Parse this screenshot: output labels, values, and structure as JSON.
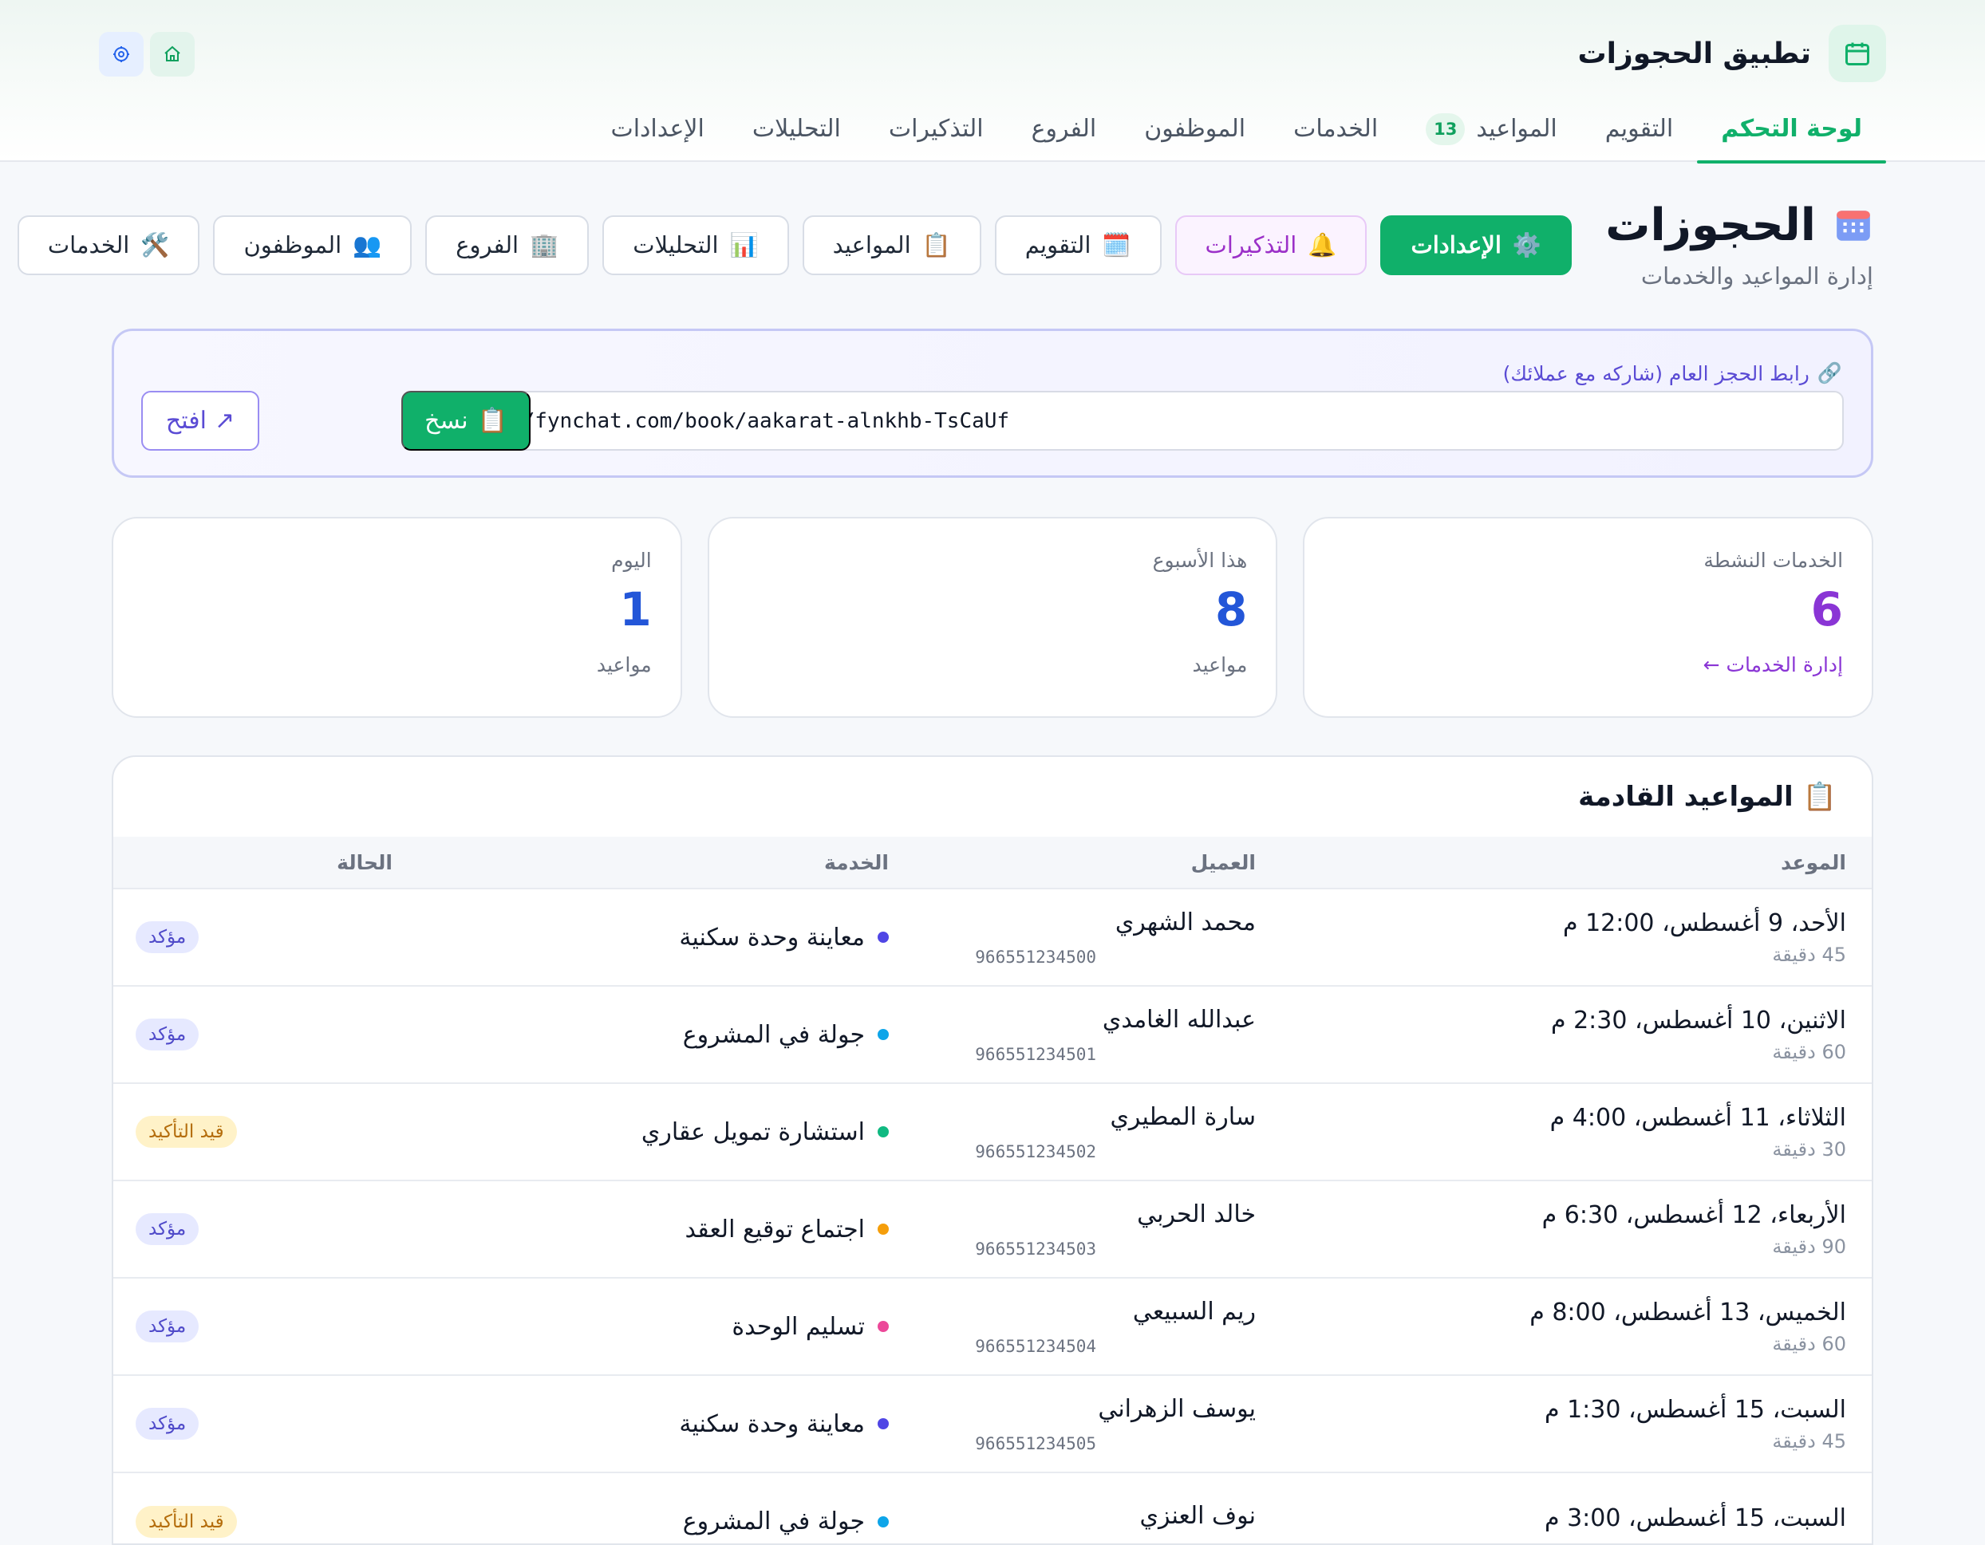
{
  "header": {
    "app_title": "تطبيق الحجوزات",
    "brand_icon": "calendar-icon",
    "top_icons": [
      "home-icon",
      "settings-icon"
    ],
    "tabs": [
      {
        "label": "لوحة التحكم",
        "active": true
      },
      {
        "label": "التقويم",
        "active": false
      },
      {
        "label": "المواعيد",
        "active": false,
        "badge": "13"
      },
      {
        "label": "الخدمات",
        "active": false
      },
      {
        "label": "الموظفون",
        "active": false
      },
      {
        "label": "الفروع",
        "active": false
      },
      {
        "label": "التذكيرات",
        "active": false
      },
      {
        "label": "التحليلات",
        "active": false
      },
      {
        "label": "الإعدادات",
        "active": false
      }
    ]
  },
  "page": {
    "title": "الحجوزات",
    "subtitle": "إدارة المواعيد والخدمات",
    "title_icon": "grid-calendar-icon",
    "quick_actions": [
      {
        "label": "الخدمات",
        "icon": "tools-icon"
      },
      {
        "label": "الموظفون",
        "icon": "users-icon"
      },
      {
        "label": "الفروع",
        "icon": "building-icon"
      },
      {
        "label": "التحليلات",
        "icon": "bar-chart-icon"
      },
      {
        "label": "المواعيد",
        "icon": "clipboard-icon"
      },
      {
        "label": "التقويم",
        "icon": "calendar-icon"
      },
      {
        "label": "التذكيرات",
        "icon": "bell-icon"
      },
      {
        "label": "الإعدادات",
        "icon": "gear-icon"
      }
    ]
  },
  "booking_link": {
    "label": "رابط الحجز العام (شاركه مع عملائك)",
    "url": "https://fynchat.com/book/aakarat-alnkhb-TsCaUf",
    "copy_label": "نسخ",
    "open_label": "افتح",
    "icons": [
      "link-icon",
      "clipboard-icon",
      "external-link-icon"
    ]
  },
  "stats": [
    {
      "label": "اليوم",
      "value": "1",
      "foot": "مواعيد",
      "color": "#2356d8"
    },
    {
      "label": "هذا الأسبوع",
      "value": "8",
      "foot": "مواعيد",
      "color": "#2356d8"
    },
    {
      "label": "الخدمات النشطة",
      "value": "6",
      "foot": "إدارة الخدمات ←",
      "color": "#8a35d5"
    }
  ],
  "upcoming": {
    "title": "المواعيد القادمة",
    "title_icon": "clipboard-icon",
    "columns": [
      "الموعد",
      "العميل",
      "الخدمة",
      "الحالة"
    ],
    "rows": [
      {
        "datetime": "الأحد، 9 أغسطس، 12:00 م",
        "duration": "45 دقيقة",
        "customer": "محمد الشهري",
        "phone": "966551234500",
        "service": "معاينة وحدة سكنية",
        "service_color": "#5046e5",
        "status": "مؤكد",
        "status_type": "confirmed"
      },
      {
        "datetime": "الاثنين، 10 أغسطس، 2:30 م",
        "duration": "60 دقيقة",
        "customer": "عبدالله الغامدي",
        "phone": "966551234501",
        "service": "جولة في المشروع",
        "service_color": "#0ea5e9",
        "status": "مؤكد",
        "status_type": "confirmed"
      },
      {
        "datetime": "الثلاثاء، 11 أغسطس، 4:00 م",
        "duration": "30 دقيقة",
        "customer": "سارة المطيري",
        "phone": "966551234502",
        "service": "استشارة تمويل عقاري",
        "service_color": "#10b981",
        "status": "قيد التأكيد",
        "status_type": "pending"
      },
      {
        "datetime": "الأربعاء، 12 أغسطس، 6:30 م",
        "duration": "90 دقيقة",
        "customer": "خالد الحربي",
        "phone": "966551234503",
        "service": "اجتماع توقيع العقد",
        "service_color": "#f59e0b",
        "status": "مؤكد",
        "status_type": "confirmed"
      },
      {
        "datetime": "الخميس، 13 أغسطس، 8:00 م",
        "duration": "60 دقيقة",
        "customer": "ريم السبيعي",
        "phone": "966551234504",
        "service": "تسليم الوحدة",
        "service_color": "#ec4899",
        "status": "مؤكد",
        "status_type": "confirmed"
      },
      {
        "datetime": "السبت، 15 أغسطس، 1:30 م",
        "duration": "45 دقيقة",
        "customer": "يوسف الزهراني",
        "phone": "966551234505",
        "service": "معاينة وحدة سكنية",
        "service_color": "#5046e5",
        "status": "مؤكد",
        "status_type": "confirmed"
      },
      {
        "datetime": "السبت، 15 أغسطس، 3:00 م",
        "duration": "",
        "customer": "نوف العنزي",
        "phone": "",
        "service": "جولة في المشروع",
        "service_color": "#0ea5e9",
        "status": "قيد التأكيد",
        "status_type": "pending"
      }
    ]
  }
}
